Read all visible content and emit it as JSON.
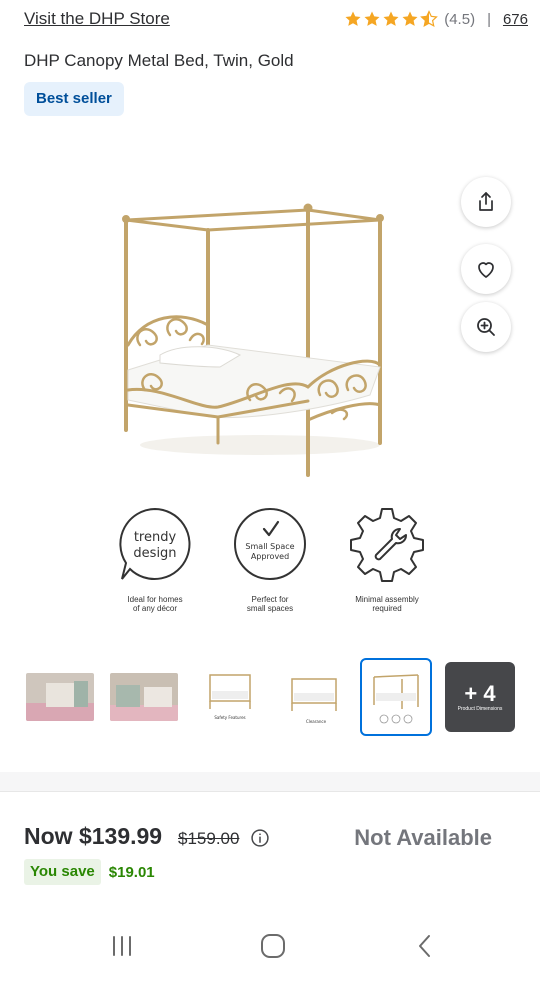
{
  "store": {
    "link": "Visit the DHP Store"
  },
  "rating": {
    "value": "(4.5)",
    "separator": "|",
    "count": "676",
    "stars": 4.5,
    "star_color": "#f5a623"
  },
  "product": {
    "title": "DHP Canopy Metal Bed, Twin, Gold"
  },
  "badge": {
    "label": "Best seller"
  },
  "features": [
    {
      "icon_text": [
        "trendy",
        "design"
      ],
      "caption": [
        "Ideal for homes",
        "of any décor"
      ]
    },
    {
      "icon_text": [
        "Small Space",
        "Approved"
      ],
      "caption": [
        "Perfect for",
        "small spaces"
      ]
    },
    {
      "icon_text": [],
      "caption": [
        "Minimal assembly",
        "required"
      ]
    }
  ],
  "thumbnails": {
    "more_label": "+ 4",
    "more_sub": "Product Dimensions",
    "thumb3_caption": "Safety Features",
    "thumb4_caption": "Clearance",
    "selected_index": 4
  },
  "price": {
    "now": "Now $139.99",
    "was": "$159.00",
    "availability": "Not Available",
    "save_label": "You save",
    "save_amount": "$19.01"
  },
  "colors": {
    "accent": "#0071dc",
    "save_green": "#2a8703",
    "badge_bg": "#e6f1fc",
    "badge_text": "#004f9a",
    "gold": "#c9a86b"
  },
  "icons": [
    "share-icon",
    "heart-icon",
    "zoom-in-icon",
    "info-icon",
    "recent-apps-icon",
    "home-icon",
    "back-icon"
  ]
}
